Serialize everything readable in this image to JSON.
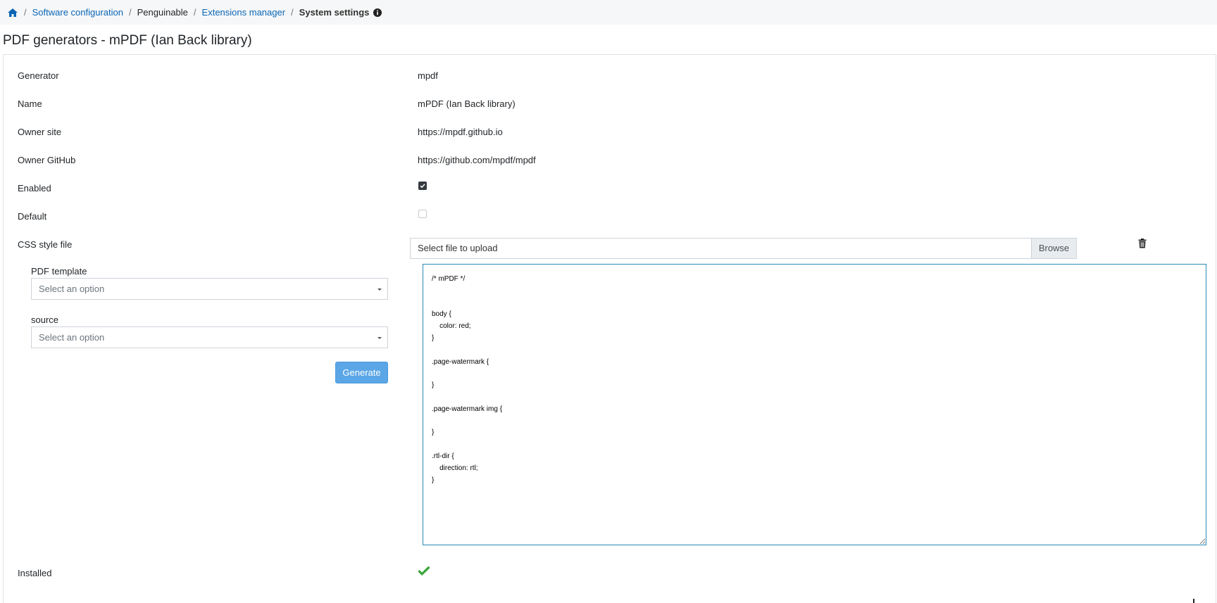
{
  "breadcrumb": {
    "items": [
      {
        "label": "Software configuration",
        "link": true
      },
      {
        "label": "Penguinable",
        "link": false
      },
      {
        "label": "Extensions manager",
        "link": true
      },
      {
        "label": "System settings",
        "link": false,
        "current": true
      }
    ],
    "separator": "/"
  },
  "page": {
    "title": "PDF generators - mPDF (Ian Back library)"
  },
  "fields": {
    "generator": {
      "label": "Generator",
      "value": "mpdf"
    },
    "name": {
      "label": "Name",
      "value": "mPDF (Ian Back library)"
    },
    "owner_site": {
      "label": "Owner site",
      "value": "https://mpdf.github.io"
    },
    "owner_github": {
      "label": "Owner GitHub",
      "value": "https://github.com/mpdf/mpdf"
    },
    "enabled": {
      "label": "Enabled",
      "checked": true
    },
    "default": {
      "label": "Default",
      "checked": false
    },
    "css_style_file": {
      "label": "CSS style file",
      "placeholder": "Select file to upload",
      "browse_label": "Browse"
    },
    "installed": {
      "label": "Installed",
      "status": true
    }
  },
  "preview": {
    "pdf_template": {
      "label": "PDF template",
      "placeholder": "Select an option"
    },
    "source": {
      "label": "source",
      "placeholder": "Select an option"
    },
    "generate_label": "Generate"
  },
  "css_editor": {
    "content": "/* mPDF */\n\n\nbody {\n\tcolor: red;\n}\n\n.page-watermark {\n\n}\n\n.page-watermark img {\n\n}\n\n.rtl-dir {\n\tdirection: rtl;\n}"
  },
  "icons": {
    "home": "home-icon",
    "info": "info-circle-icon",
    "trash": "trash-icon",
    "check": "check-icon"
  },
  "colors": {
    "link": "#0a66b5",
    "primary_button": "#5aa6e6",
    "success": "#3aa53a",
    "checkbox_checked": "#343a40",
    "editor_border": "#2a8bb5"
  }
}
